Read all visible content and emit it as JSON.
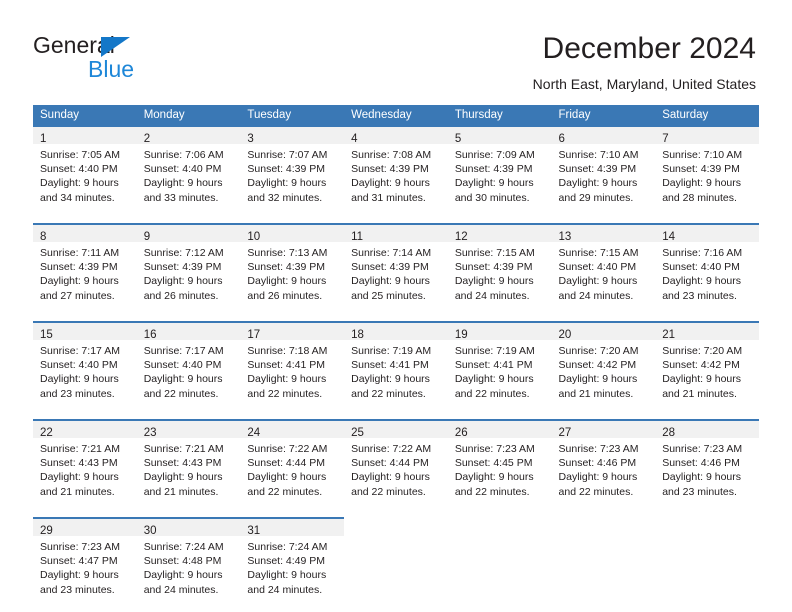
{
  "brand": {
    "name_top": "General",
    "name_bottom": "Blue",
    "triangle_color": "#1477c8",
    "blue_text_color": "#1e87d8"
  },
  "header": {
    "title": "December 2024",
    "subtitle": "North East, Maryland, United States"
  },
  "theme": {
    "header_blue": "#3a78b5",
    "row_band_gray": "#f1f1f1",
    "text_color": "#231f20"
  },
  "calendar": {
    "weekday_headers": [
      "Sunday",
      "Monday",
      "Tuesday",
      "Wednesday",
      "Thursday",
      "Friday",
      "Saturday"
    ],
    "weeks": [
      [
        {
          "day": "1",
          "sunrise": "Sunrise: 7:05 AM",
          "sunset": "Sunset: 4:40 PM",
          "daylight_line1": "Daylight: 9 hours",
          "daylight_line2": "and 34 minutes."
        },
        {
          "day": "2",
          "sunrise": "Sunrise: 7:06 AM",
          "sunset": "Sunset: 4:40 PM",
          "daylight_line1": "Daylight: 9 hours",
          "daylight_line2": "and 33 minutes."
        },
        {
          "day": "3",
          "sunrise": "Sunrise: 7:07 AM",
          "sunset": "Sunset: 4:39 PM",
          "daylight_line1": "Daylight: 9 hours",
          "daylight_line2": "and 32 minutes."
        },
        {
          "day": "4",
          "sunrise": "Sunrise: 7:08 AM",
          "sunset": "Sunset: 4:39 PM",
          "daylight_line1": "Daylight: 9 hours",
          "daylight_line2": "and 31 minutes."
        },
        {
          "day": "5",
          "sunrise": "Sunrise: 7:09 AM",
          "sunset": "Sunset: 4:39 PM",
          "daylight_line1": "Daylight: 9 hours",
          "daylight_line2": "and 30 minutes."
        },
        {
          "day": "6",
          "sunrise": "Sunrise: 7:10 AM",
          "sunset": "Sunset: 4:39 PM",
          "daylight_line1": "Daylight: 9 hours",
          "daylight_line2": "and 29 minutes."
        },
        {
          "day": "7",
          "sunrise": "Sunrise: 7:10 AM",
          "sunset": "Sunset: 4:39 PM",
          "daylight_line1": "Daylight: 9 hours",
          "daylight_line2": "and 28 minutes."
        }
      ],
      [
        {
          "day": "8",
          "sunrise": "Sunrise: 7:11 AM",
          "sunset": "Sunset: 4:39 PM",
          "daylight_line1": "Daylight: 9 hours",
          "daylight_line2": "and 27 minutes."
        },
        {
          "day": "9",
          "sunrise": "Sunrise: 7:12 AM",
          "sunset": "Sunset: 4:39 PM",
          "daylight_line1": "Daylight: 9 hours",
          "daylight_line2": "and 26 minutes."
        },
        {
          "day": "10",
          "sunrise": "Sunrise: 7:13 AM",
          "sunset": "Sunset: 4:39 PM",
          "daylight_line1": "Daylight: 9 hours",
          "daylight_line2": "and 26 minutes."
        },
        {
          "day": "11",
          "sunrise": "Sunrise: 7:14 AM",
          "sunset": "Sunset: 4:39 PM",
          "daylight_line1": "Daylight: 9 hours",
          "daylight_line2": "and 25 minutes."
        },
        {
          "day": "12",
          "sunrise": "Sunrise: 7:15 AM",
          "sunset": "Sunset: 4:39 PM",
          "daylight_line1": "Daylight: 9 hours",
          "daylight_line2": "and 24 minutes."
        },
        {
          "day": "13",
          "sunrise": "Sunrise: 7:15 AM",
          "sunset": "Sunset: 4:40 PM",
          "daylight_line1": "Daylight: 9 hours",
          "daylight_line2": "and 24 minutes."
        },
        {
          "day": "14",
          "sunrise": "Sunrise: 7:16 AM",
          "sunset": "Sunset: 4:40 PM",
          "daylight_line1": "Daylight: 9 hours",
          "daylight_line2": "and 23 minutes."
        }
      ],
      [
        {
          "day": "15",
          "sunrise": "Sunrise: 7:17 AM",
          "sunset": "Sunset: 4:40 PM",
          "daylight_line1": "Daylight: 9 hours",
          "daylight_line2": "and 23 minutes."
        },
        {
          "day": "16",
          "sunrise": "Sunrise: 7:17 AM",
          "sunset": "Sunset: 4:40 PM",
          "daylight_line1": "Daylight: 9 hours",
          "daylight_line2": "and 22 minutes."
        },
        {
          "day": "17",
          "sunrise": "Sunrise: 7:18 AM",
          "sunset": "Sunset: 4:41 PM",
          "daylight_line1": "Daylight: 9 hours",
          "daylight_line2": "and 22 minutes."
        },
        {
          "day": "18",
          "sunrise": "Sunrise: 7:19 AM",
          "sunset": "Sunset: 4:41 PM",
          "daylight_line1": "Daylight: 9 hours",
          "daylight_line2": "and 22 minutes."
        },
        {
          "day": "19",
          "sunrise": "Sunrise: 7:19 AM",
          "sunset": "Sunset: 4:41 PM",
          "daylight_line1": "Daylight: 9 hours",
          "daylight_line2": "and 22 minutes."
        },
        {
          "day": "20",
          "sunrise": "Sunrise: 7:20 AM",
          "sunset": "Sunset: 4:42 PM",
          "daylight_line1": "Daylight: 9 hours",
          "daylight_line2": "and 21 minutes."
        },
        {
          "day": "21",
          "sunrise": "Sunrise: 7:20 AM",
          "sunset": "Sunset: 4:42 PM",
          "daylight_line1": "Daylight: 9 hours",
          "daylight_line2": "and 21 minutes."
        }
      ],
      [
        {
          "day": "22",
          "sunrise": "Sunrise: 7:21 AM",
          "sunset": "Sunset: 4:43 PM",
          "daylight_line1": "Daylight: 9 hours",
          "daylight_line2": "and 21 minutes."
        },
        {
          "day": "23",
          "sunrise": "Sunrise: 7:21 AM",
          "sunset": "Sunset: 4:43 PM",
          "daylight_line1": "Daylight: 9 hours",
          "daylight_line2": "and 21 minutes."
        },
        {
          "day": "24",
          "sunrise": "Sunrise: 7:22 AM",
          "sunset": "Sunset: 4:44 PM",
          "daylight_line1": "Daylight: 9 hours",
          "daylight_line2": "and 22 minutes."
        },
        {
          "day": "25",
          "sunrise": "Sunrise: 7:22 AM",
          "sunset": "Sunset: 4:44 PM",
          "daylight_line1": "Daylight: 9 hours",
          "daylight_line2": "and 22 minutes."
        },
        {
          "day": "26",
          "sunrise": "Sunrise: 7:23 AM",
          "sunset": "Sunset: 4:45 PM",
          "daylight_line1": "Daylight: 9 hours",
          "daylight_line2": "and 22 minutes."
        },
        {
          "day": "27",
          "sunrise": "Sunrise: 7:23 AM",
          "sunset": "Sunset: 4:46 PM",
          "daylight_line1": "Daylight: 9 hours",
          "daylight_line2": "and 22 minutes."
        },
        {
          "day": "28",
          "sunrise": "Sunrise: 7:23 AM",
          "sunset": "Sunset: 4:46 PM",
          "daylight_line1": "Daylight: 9 hours",
          "daylight_line2": "and 23 minutes."
        }
      ],
      [
        {
          "day": "29",
          "sunrise": "Sunrise: 7:23 AM",
          "sunset": "Sunset: 4:47 PM",
          "daylight_line1": "Daylight: 9 hours",
          "daylight_line2": "and 23 minutes."
        },
        {
          "day": "30",
          "sunrise": "Sunrise: 7:24 AM",
          "sunset": "Sunset: 4:48 PM",
          "daylight_line1": "Daylight: 9 hours",
          "daylight_line2": "and 24 minutes."
        },
        {
          "day": "31",
          "sunrise": "Sunrise: 7:24 AM",
          "sunset": "Sunset: 4:49 PM",
          "daylight_line1": "Daylight: 9 hours",
          "daylight_line2": "and 24 minutes."
        },
        {
          "day": "",
          "sunrise": "",
          "sunset": "",
          "daylight_line1": "",
          "daylight_line2": ""
        },
        {
          "day": "",
          "sunrise": "",
          "sunset": "",
          "daylight_line1": "",
          "daylight_line2": ""
        },
        {
          "day": "",
          "sunrise": "",
          "sunset": "",
          "daylight_line1": "",
          "daylight_line2": ""
        },
        {
          "day": "",
          "sunrise": "",
          "sunset": "",
          "daylight_line1": "",
          "daylight_line2": ""
        }
      ]
    ]
  }
}
